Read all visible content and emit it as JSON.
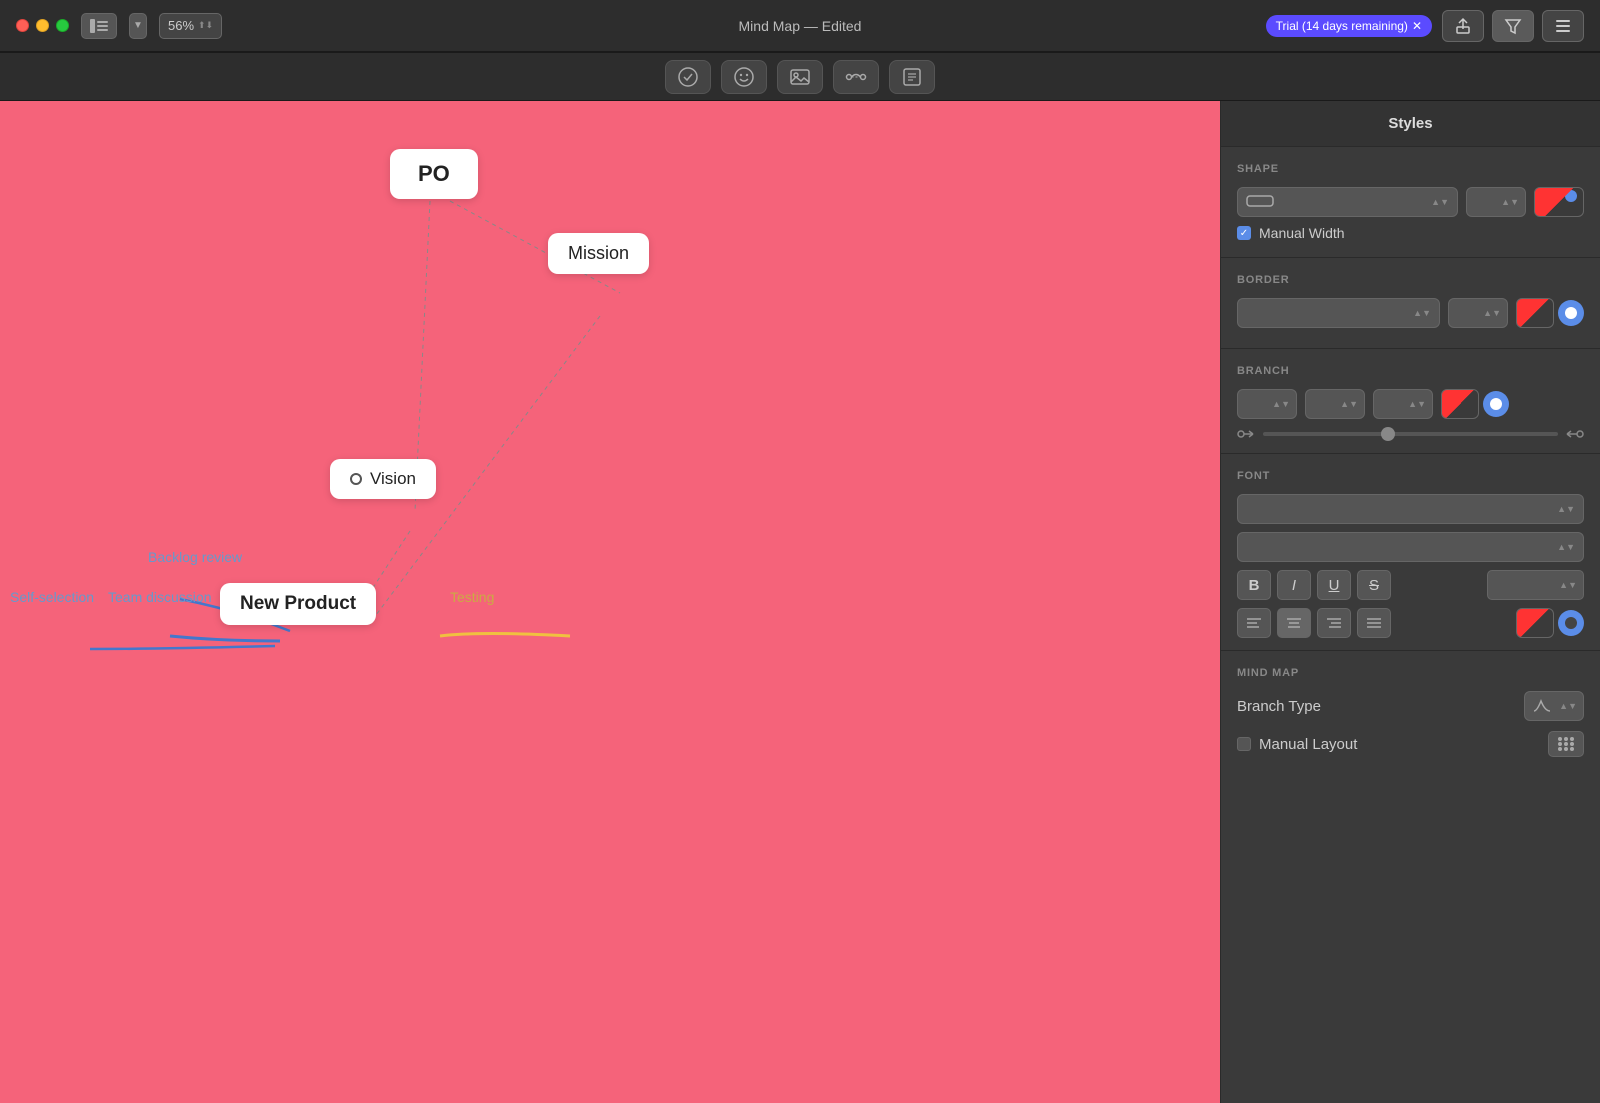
{
  "titlebar": {
    "title": "Mind Map — Edited",
    "zoom": "56%",
    "trial_badge": "Trial (14 days remaining)"
  },
  "toolbar": {
    "tools": [
      "✓",
      "☺",
      "⛰",
      "⇄",
      "💬"
    ]
  },
  "canvas": {
    "nodes": [
      {
        "id": "po",
        "label": "PO"
      },
      {
        "id": "mission",
        "label": "Mission"
      },
      {
        "id": "vision",
        "label": "Vision"
      },
      {
        "id": "new_product",
        "label": "New Product"
      }
    ],
    "branch_labels": [
      {
        "id": "backlog",
        "label": "Backlog review",
        "color": "#6699cc"
      },
      {
        "id": "team",
        "label": "Team discussion",
        "color": "#6699cc"
      },
      {
        "id": "self",
        "label": "Self-selection",
        "color": "#6699cc"
      },
      {
        "id": "testing",
        "label": "Testing",
        "color": "#ccaa44"
      }
    ]
  },
  "panel": {
    "title": "Styles",
    "sections": {
      "shape": {
        "label": "SHAPE",
        "manual_width": "Manual Width"
      },
      "border": {
        "label": "BORDER"
      },
      "branch": {
        "label": "BRANCH"
      },
      "font": {
        "label": "FONT",
        "style_buttons": [
          "B",
          "I",
          "U",
          "S"
        ]
      },
      "mind_map": {
        "label": "MIND MAP",
        "branch_type_label": "Branch Type",
        "manual_layout_label": "Manual Layout"
      }
    }
  }
}
